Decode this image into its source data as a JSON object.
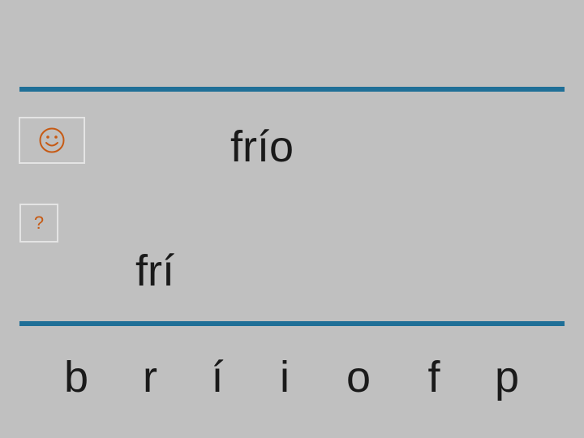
{
  "target": {
    "word": "frío"
  },
  "answer": {
    "text": "frí"
  },
  "help": {
    "label": "?"
  },
  "icons": {
    "feedback": "smiley-face-icon"
  },
  "colors": {
    "background": "#c0c0c0",
    "rule": "#1f6f97",
    "box_border": "#e4e4e4",
    "accent": "#c65a14",
    "text": "#1a1a1a"
  },
  "letters": [
    "b",
    "r",
    "í",
    "i",
    "o",
    "f",
    "p"
  ]
}
